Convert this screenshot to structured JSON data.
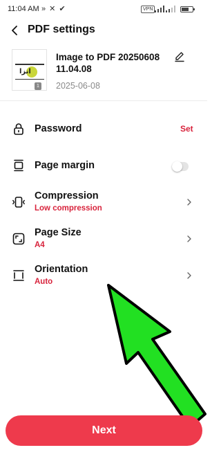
{
  "status_bar": {
    "time": "11:04 AM",
    "left_icons": "» ✕ ✔",
    "vpn": "VPN",
    "battery_level": 0.65
  },
  "header": {
    "title": "PDF settings"
  },
  "file": {
    "name": "Image to PDF 20250608 11.04.08",
    "date": "2025-06-08",
    "thumbnail_text": "انزا",
    "page_count": "1"
  },
  "settings": {
    "password": {
      "label": "Password",
      "action": "Set"
    },
    "page_margin": {
      "label": "Page margin",
      "enabled": false
    },
    "compression": {
      "label": "Compression",
      "value": "Low compression"
    },
    "page_size": {
      "label": "Page Size",
      "value": "A4"
    },
    "orientation": {
      "label": "Orientation",
      "value": "Auto"
    }
  },
  "footer": {
    "next_label": "Next"
  },
  "colors": {
    "accent": "#d8233c",
    "button": "#ee3a4c",
    "arrow": "#22e022"
  },
  "icons": [
    "back-arrow-icon",
    "edit-pencil-icon",
    "lock-icon",
    "page-margin-icon",
    "compression-icon",
    "page-size-icon",
    "orientation-icon",
    "chevron-right-icon"
  ]
}
